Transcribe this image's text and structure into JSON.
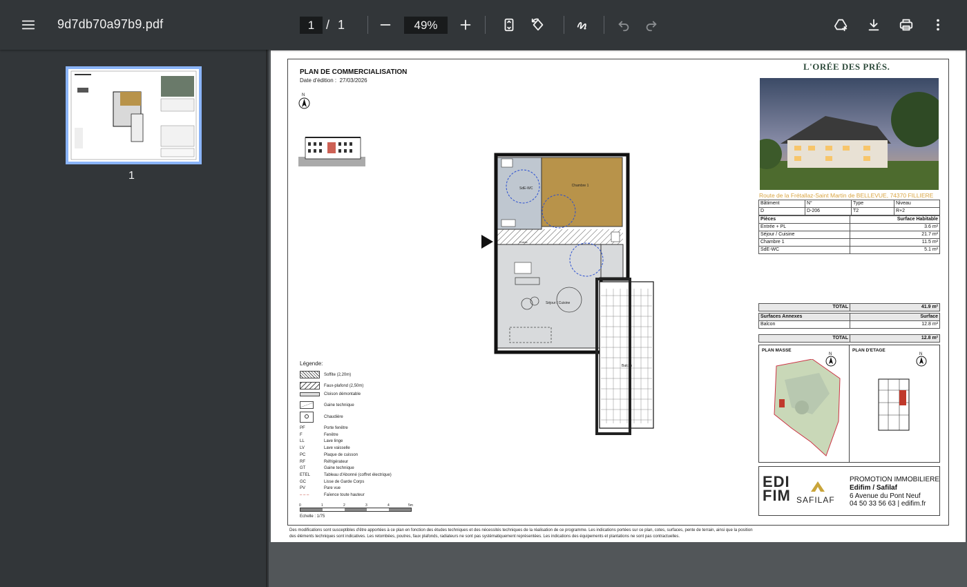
{
  "toolbar": {
    "file_name": "9d7db70a97b9.pdf",
    "current_page": "1",
    "page_separator": "/",
    "total_pages": "1",
    "zoom": "49%",
    "icons": [
      "menu-icon",
      "zoom-out-icon",
      "zoom-in-icon",
      "fit-page-icon",
      "rotate-icon",
      "annotate-icon",
      "undo-icon",
      "redo-icon",
      "save-to-drive-icon",
      "download-icon",
      "print-icon",
      "more-icon"
    ]
  },
  "sidebar": {
    "thumbnails": [
      {
        "label": "1"
      }
    ]
  },
  "document": {
    "title": "PLAN DE COMMERCIALISATION",
    "date_label": "Date d'édition :",
    "date": "27/03/2026",
    "north": "N",
    "brand": "L'ORÉE DES PRÉS.",
    "address": "Route de la Frétallaz-Saint Martin de BELLEVUE, 74370 FILLIERE",
    "lot": {
      "headers": [
        "Bâtiment",
        "N°",
        "Type",
        "Niveau"
      ],
      "values": [
        "D",
        "D-206",
        "T2",
        "R+2"
      ]
    },
    "rooms": {
      "header_left": "Pièces",
      "header_right": "Surface Habitable",
      "rows": [
        {
          "name": "Entrée + PL",
          "area": "3.6 m²"
        },
        {
          "name": "Séjour / Cuisine",
          "area": "21.7 m²"
        },
        {
          "name": "Chambre 1",
          "area": "11.5 m²"
        },
        {
          "name": "SdE-WC",
          "area": "5.1 m²"
        }
      ],
      "total_label": "TOTAL",
      "total": "41.9 m²"
    },
    "annexes": {
      "header_left": "Surfaces Annexes",
      "header_right": "Surface",
      "rows": [
        {
          "name": "Balcon",
          "area": "12.8 m²"
        }
      ],
      "total_label": "TOTAL",
      "total": "12.8 m²"
    },
    "plan_masse": "PLAN MASSE",
    "plan_etage": "PLAN D'ETAGE",
    "promo": {
      "logo_left": "EDI FIM",
      "logo_right": "SAFILAF",
      "line1": "PROMOTION IMMOBILIERE",
      "line2": "Edifim / Safilaf",
      "line3": "6 Avenue du Pont Neuf",
      "line4": "04 50 33 56 63 | edifim.fr"
    },
    "plan_labels": {
      "chambre": "Chambre 1",
      "sde": "SdE-WC",
      "sejour": "Séjour / Cuisine",
      "entree": "Entrée",
      "balcon": "Balcon"
    },
    "legend": {
      "title": "Légende:",
      "swatches": [
        "Soffite (2,20m)",
        "Faux-plafond (2,50m)",
        "Cloison démontable",
        "Gaine technique",
        "Chaudière"
      ],
      "abbreviations": [
        {
          "k": "PF",
          "v": "Porte fenêtre"
        },
        {
          "k": "F",
          "v": "Fenêtre"
        },
        {
          "k": "LL",
          "v": "Lave linge"
        },
        {
          "k": "LV",
          "v": "Lave vaisselle"
        },
        {
          "k": "PC",
          "v": "Plaque de cuisson"
        },
        {
          "k": "RF",
          "v": "Réfrigérateur"
        },
        {
          "k": "GT",
          "v": "Gaine technique"
        },
        {
          "k": "ETEL",
          "v": "Tableau d'Abonné (coffret électrique)"
        },
        {
          "k": "GC",
          "v": "Lisse de Garde Corps"
        },
        {
          "k": "PV",
          "v": "Pare vue"
        },
        {
          "k": "– – –",
          "v": "Faïence toute hauteur"
        }
      ]
    },
    "scale": {
      "ticks": [
        "0",
        "1",
        "2",
        "3",
        "4",
        "5m"
      ],
      "label": "Echelle : 1/75"
    },
    "footer": "Des modifications sont susceptibles d'être apportées à ce plan en fonction des études techniques et des nécessités techniques de la réalisation de ce programme.   Les indications portées sur ce plan, cotes, surfaces, pente de terrain, ainsi que la position des éléments techniques sont indicatives.  Les retombées, poutres, faux plafonds, radiateurs ne sont pas systématiquement représentées. Les indications des équipements et plantations ne sont pas contractuelles."
  }
}
